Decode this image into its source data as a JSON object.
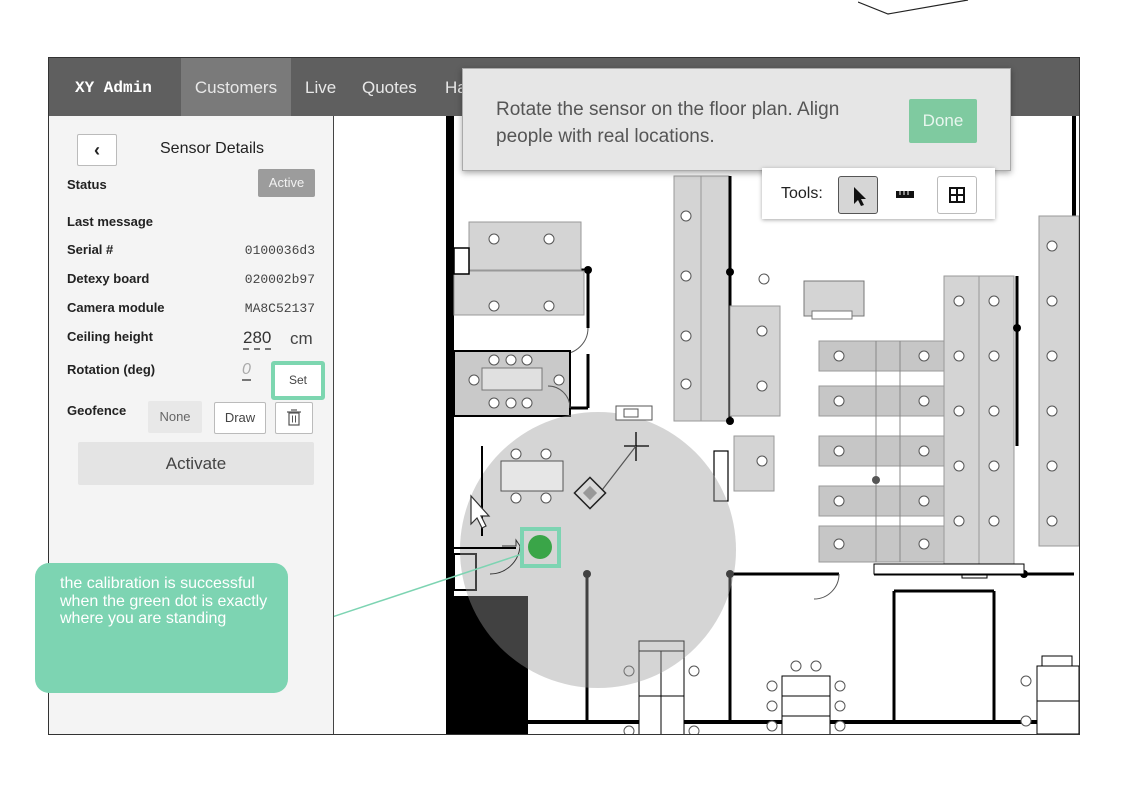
{
  "nav": {
    "brand": "XY Admin",
    "items": [
      "Customers",
      "Live",
      "Quotes",
      "Ha"
    ],
    "active": "Customers"
  },
  "sidebar": {
    "back_icon": "chevron-left-icon",
    "title": "Sensor Details",
    "status_label": "Status",
    "status_value": "Active",
    "last_message_label": "Last message",
    "serial_label": "Serial #",
    "serial_value": "0100036d3",
    "board_label": "Detexy board",
    "board_value": "020002b97",
    "camera_label": "Camera module",
    "camera_value": "MA8C52137",
    "ceiling_label": "Ceiling height",
    "ceiling_value": "280",
    "ceiling_unit": "cm",
    "rotation_label": "Rotation (deg)",
    "rotation_value": "0",
    "set_label": "Set",
    "geofence_label": "Geofence",
    "geofence_none": "None",
    "geofence_draw": "Draw",
    "trash_icon": "trash-icon",
    "activate_label": "Activate"
  },
  "instruction": {
    "text": "Rotate the sensor on the floor plan. Align people with real locations.",
    "done_label": "Done"
  },
  "toolbar": {
    "label": "Tools:",
    "tools": [
      "pointer-icon",
      "ruler-icon",
      "grid-icon"
    ]
  },
  "callout": {
    "text": "the calibration is successful when the green dot is exactly where you are standing"
  },
  "colors": {
    "topbar": "#5f5f5f",
    "accent_green": "#7dd4b2",
    "person_dot": "#3aa548",
    "done_button": "#7fcaa0"
  }
}
